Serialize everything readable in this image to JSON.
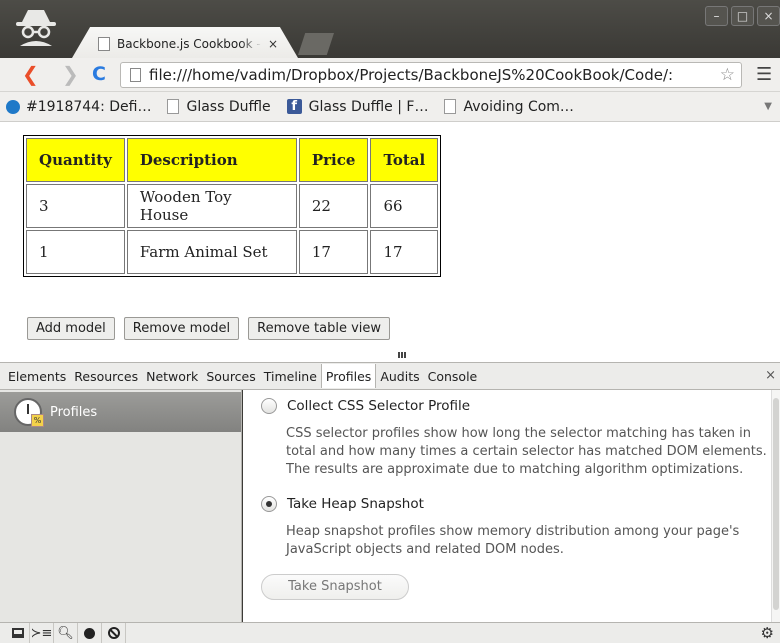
{
  "browser": {
    "tab_title": "Backbone.js Cookbook - A",
    "tab_close": "×",
    "address": "file:///home/vadim/Dropbox/Projects/BackboneJS%20CookBook/Code/:",
    "window_buttons": [
      "–",
      "□",
      "×"
    ],
    "bookmarks": [
      {
        "label": "#1918744: Defi…",
        "icon": "drupal-icon"
      },
      {
        "label": "Glass Duffle",
        "icon": "page-icon"
      },
      {
        "label": "Glass Duffle | F…",
        "icon": "facebook-icon"
      },
      {
        "label": "Avoiding Com…",
        "icon": "page-icon"
      }
    ]
  },
  "table": {
    "headers": [
      "Quantity",
      "Description",
      "Price",
      "Total"
    ],
    "rows": [
      [
        "3",
        "Wooden Toy House",
        "22",
        "66"
      ],
      [
        "1",
        "Farm Animal Set",
        "17",
        "17"
      ]
    ],
    "header_color": "#ffff00"
  },
  "buttons": {
    "add": "Add model",
    "remove": "Remove model",
    "remove_view": "Remove table view"
  },
  "devtools": {
    "tabs": [
      "Elements",
      "Resources",
      "Network",
      "Sources",
      "Timeline",
      "Profiles",
      "Audits",
      "Console"
    ],
    "active_tab": "Profiles",
    "close": "×",
    "sidebar_item": "Profiles",
    "options": [
      {
        "title": "Collect CSS Selector Profile",
        "desc": "CSS selector profiles show how long the selector matching has taken in total and how many times a certain selector has matched DOM elements. The results are approximate due to matching algorithm optimizations.",
        "checked": false
      },
      {
        "title": "Take Heap Snapshot",
        "desc": "Heap snapshot profiles show memory distribution among your page's JavaScript objects and related DOM nodes.",
        "checked": true
      }
    ],
    "action_button": "Take Snapshot"
  }
}
